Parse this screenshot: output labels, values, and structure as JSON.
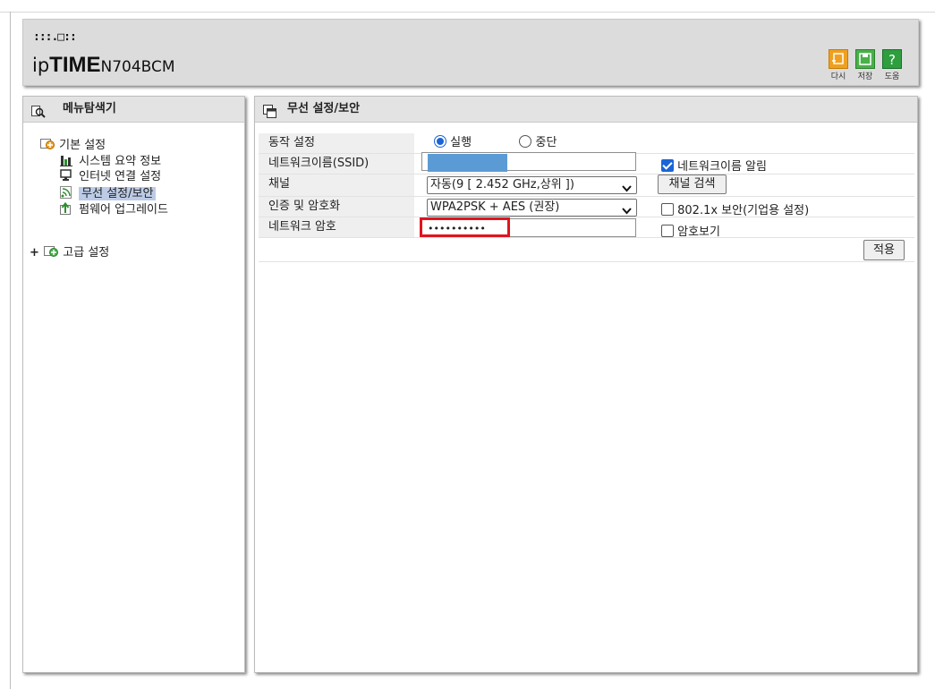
{
  "brand": {
    "logo_dots": ":::.□::",
    "logo_ip": "ip",
    "logo_time": "TIME",
    "model": "N704BCM"
  },
  "header_buttons": [
    {
      "label": "다시",
      "icon": "refresh-icon"
    },
    {
      "label": "저장",
      "icon": "save-icon"
    },
    {
      "label": "도움",
      "icon": "help-icon"
    }
  ],
  "menu_panel": {
    "title": "메뉴탐색기",
    "basic": {
      "label": "기본 설정",
      "items": [
        {
          "label": "시스템 요약 정보",
          "icon": "bar-chart-icon"
        },
        {
          "label": "인터넷 연결 설정",
          "icon": "monitor-icon"
        },
        {
          "label": "무선 설정/보안",
          "icon": "wireless-icon"
        },
        {
          "label": "펌웨어 업그레이드",
          "icon": "upgrade-icon"
        }
      ]
    },
    "advanced": {
      "label": "고급 설정",
      "expander": "+"
    }
  },
  "content": {
    "title": "무선 설정/보안",
    "operation": {
      "label": "동작 설정",
      "options": [
        "실행",
        "중단"
      ],
      "selected": "실행"
    },
    "ssid": {
      "label": "네트워크이름(SSID)",
      "broadcast_label": "네트워크이름 알림",
      "broadcast_checked": true
    },
    "channel": {
      "label": "채널",
      "value": "자동(9 [ 2.452 GHz,상위 ])",
      "search_button": "채널 검색"
    },
    "auth": {
      "label": "인증 및 암호화",
      "value": "WPA2PSK + AES (권장)",
      "enterprise_label": "802.1x 보안(기업용 설정)",
      "enterprise_checked": false
    },
    "password": {
      "label": "네트워크 암호",
      "value": "••••••••••",
      "show_label": "암호보기",
      "show_checked": false
    },
    "apply_button": "적용"
  },
  "colors": {
    "highlight": "#e0141e",
    "redaction": "#5b9bd5",
    "selection": "#bccbe6"
  }
}
